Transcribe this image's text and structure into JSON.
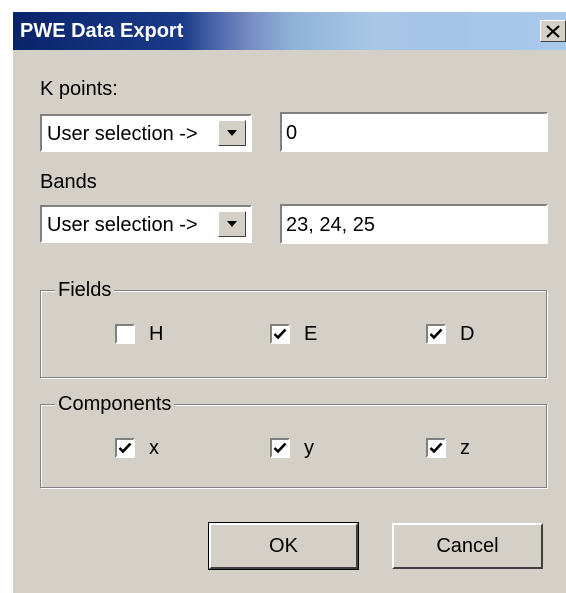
{
  "window": {
    "title": "PWE Data Export",
    "close_glyph": "✕"
  },
  "kpoints": {
    "label": "K points:",
    "mode": "User selection ->",
    "value": "0"
  },
  "bands": {
    "label": "Bands",
    "mode": "User selection ->",
    "value": "23, 24, 25"
  },
  "fields": {
    "title": "Fields",
    "items": [
      {
        "label": "H",
        "checked": false
      },
      {
        "label": "E",
        "checked": true
      },
      {
        "label": "D",
        "checked": true
      }
    ]
  },
  "components": {
    "title": "Components",
    "items": [
      {
        "label": "x",
        "checked": true
      },
      {
        "label": "y",
        "checked": true
      },
      {
        "label": "z",
        "checked": true
      }
    ]
  },
  "buttons": {
    "ok": "OK",
    "cancel": "Cancel"
  },
  "colors": {
    "titlebar_start": "#0a246a",
    "dialog_face": "#d4d0c8"
  },
  "icons": {
    "dropdown_arrow": "dropdown-arrow-icon",
    "close": "close-icon",
    "check": "check-icon"
  }
}
